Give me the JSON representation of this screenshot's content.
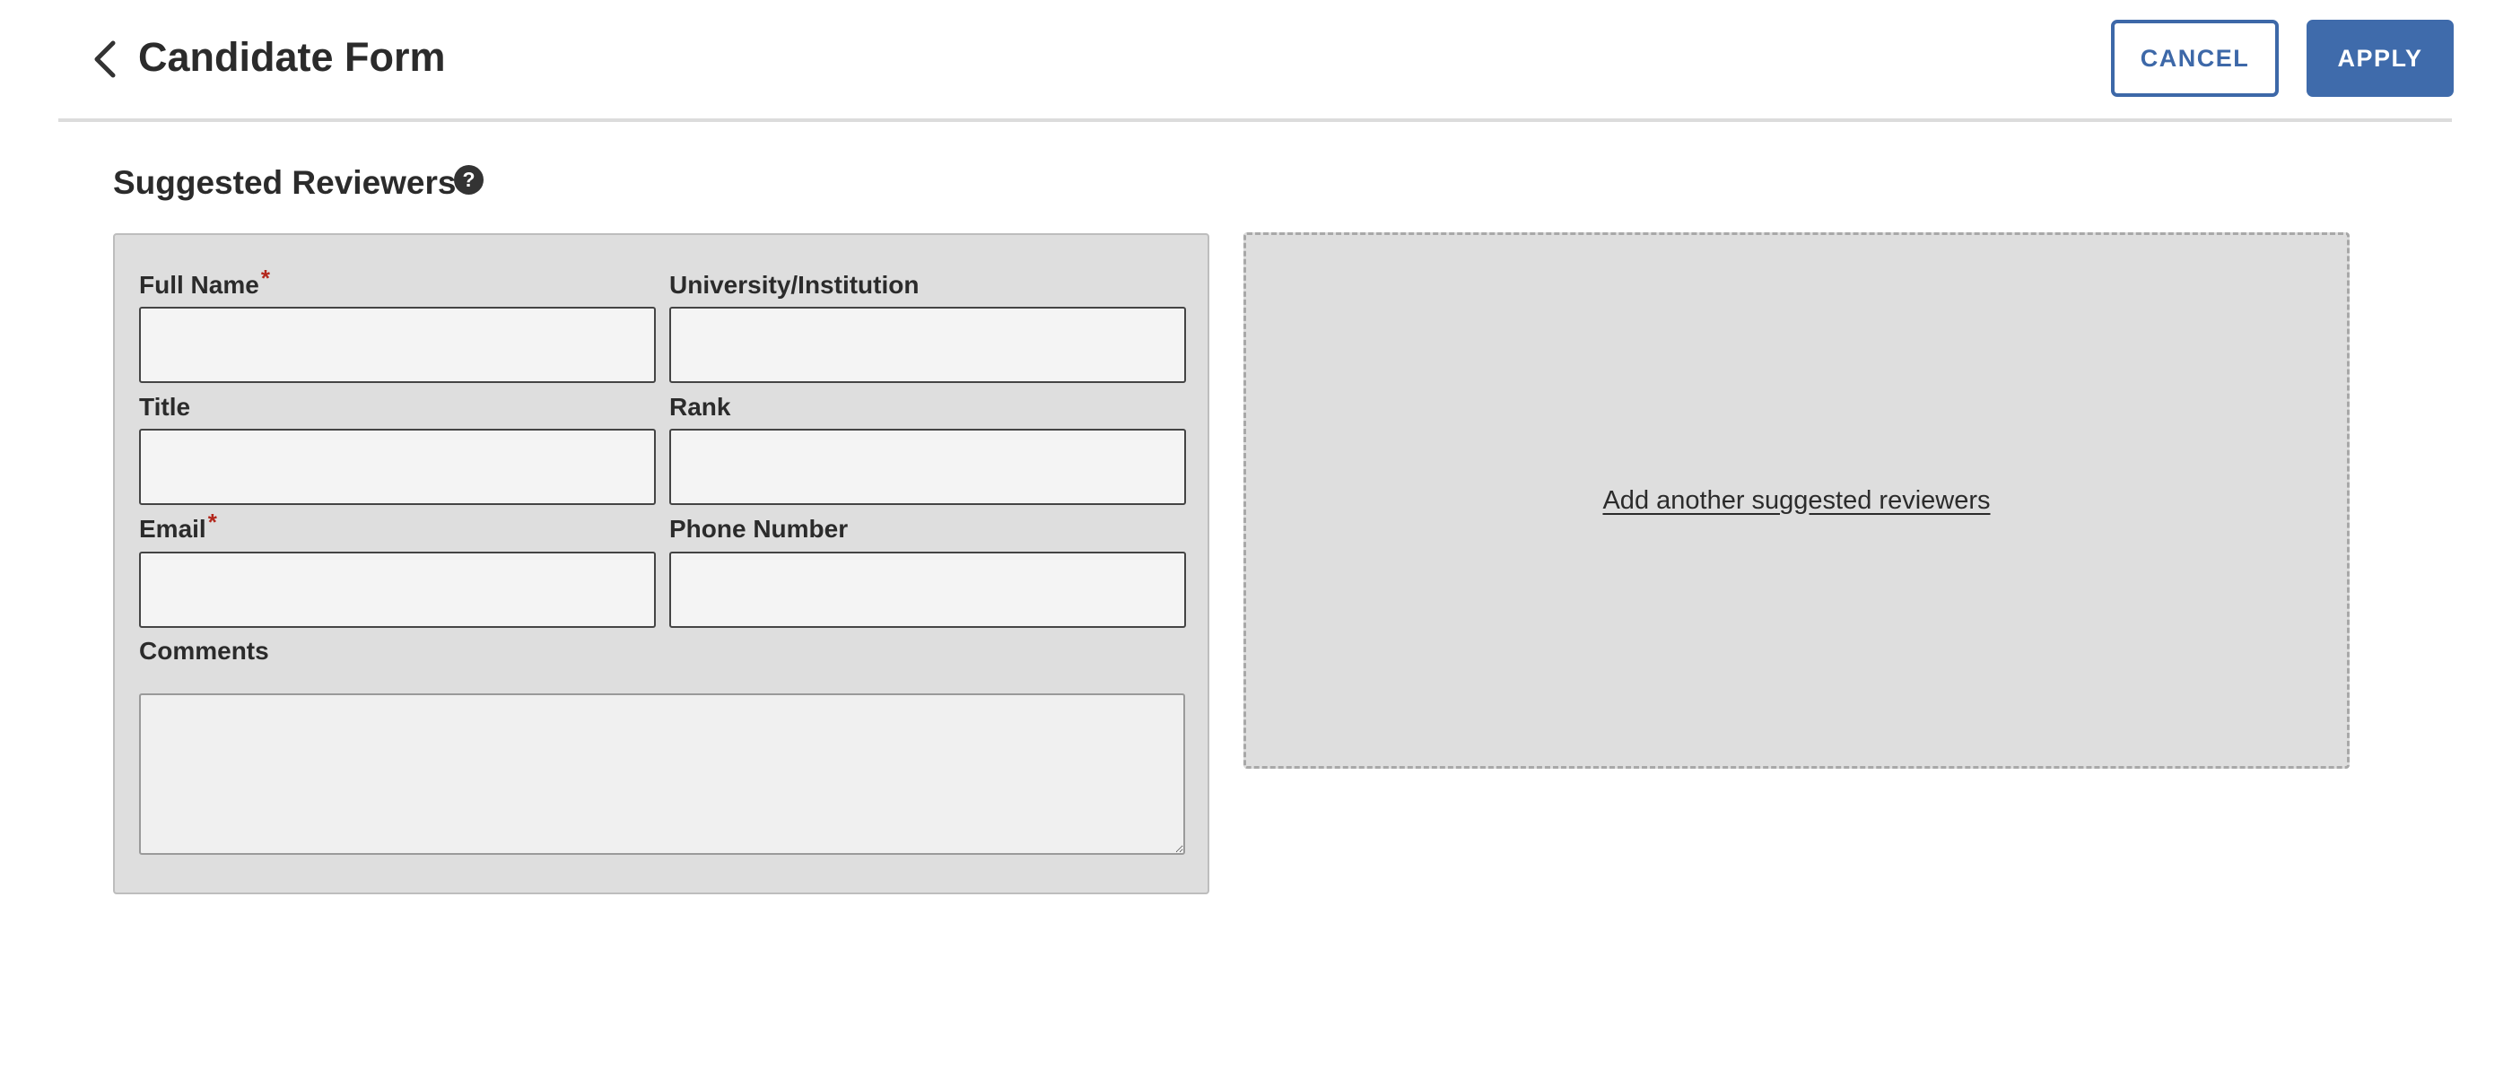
{
  "header": {
    "title": "Candidate Form",
    "back_icon": "chevron-left-icon",
    "cancel_label": "CANCEL",
    "apply_label": "APPLY",
    "accent_color": "#3f6bab"
  },
  "section": {
    "title": "Suggested Reviewers",
    "help_icon": "question-circle-icon",
    "help_glyph": "?"
  },
  "form": {
    "required_marker": "*",
    "required_color": "#b3271c",
    "full_name": {
      "label": "Full Name",
      "value": ""
    },
    "institution": {
      "label": "University/Institution",
      "value": ""
    },
    "title": {
      "label": "Title",
      "value": ""
    },
    "rank": {
      "label": "Rank",
      "value": ""
    },
    "email": {
      "label": "Email",
      "value": ""
    },
    "phone": {
      "label": "Phone Number",
      "value": ""
    },
    "comments": {
      "label": "Comments",
      "value": ""
    }
  },
  "add_reviewer": {
    "label": "Add another suggested reviewers"
  }
}
